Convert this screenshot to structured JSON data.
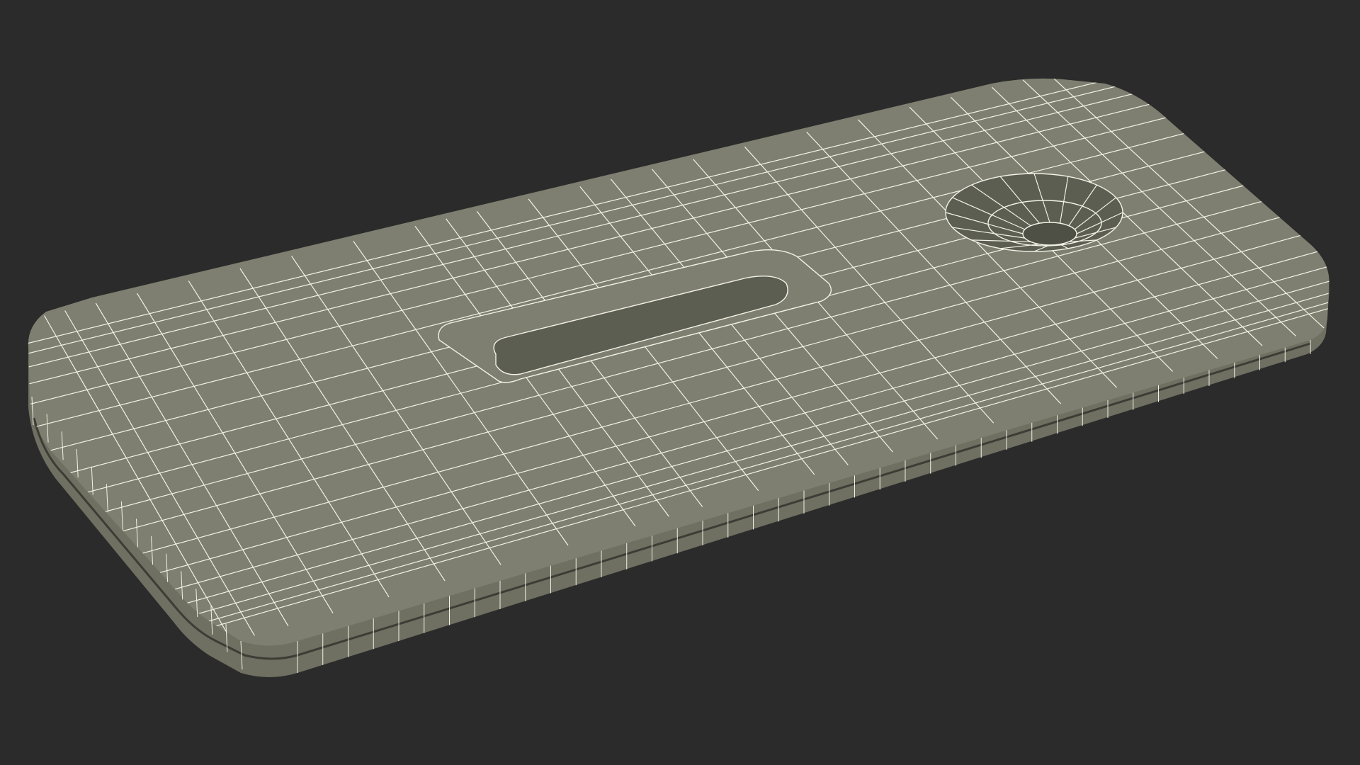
{
  "scene": {
    "background_color": "#2b2b2b",
    "body_color": "#7e7f70",
    "side_color": "#6f7062",
    "edge_dark_color": "#3c3d35",
    "recess_color": "#5d5e52",
    "wire_color": "#f2f2e6",
    "object": "wireframe-phone-case-model"
  }
}
